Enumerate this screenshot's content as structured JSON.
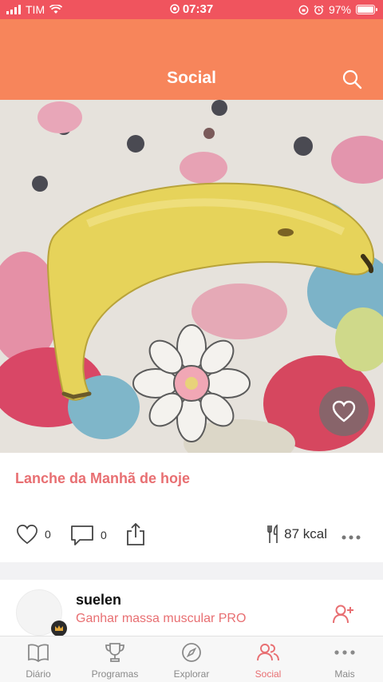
{
  "status_bar": {
    "carrier": "TIM",
    "time": "07:37",
    "battery": "97%"
  },
  "header": {
    "title": "Social",
    "search_icon": "search-icon"
  },
  "post": {
    "image_subject": "banana",
    "title": "Lanche da Manhã de hoje",
    "likes": "0",
    "comments": "0",
    "calories": "87 kcal"
  },
  "user": {
    "name": "suelen",
    "goal": "Ganhar massa muscular PRO"
  },
  "tabs": [
    {
      "label": "Diário",
      "icon": "book-icon"
    },
    {
      "label": "Programas",
      "icon": "trophy-icon"
    },
    {
      "label": "Explorar",
      "icon": "compass-icon"
    },
    {
      "label": "Social",
      "icon": "users-icon"
    },
    {
      "label": "Mais",
      "icon": "more-icon"
    }
  ],
  "colors": {
    "status_bar": "#f0545e",
    "header": "#f7855b",
    "accent": "#e86f72"
  }
}
